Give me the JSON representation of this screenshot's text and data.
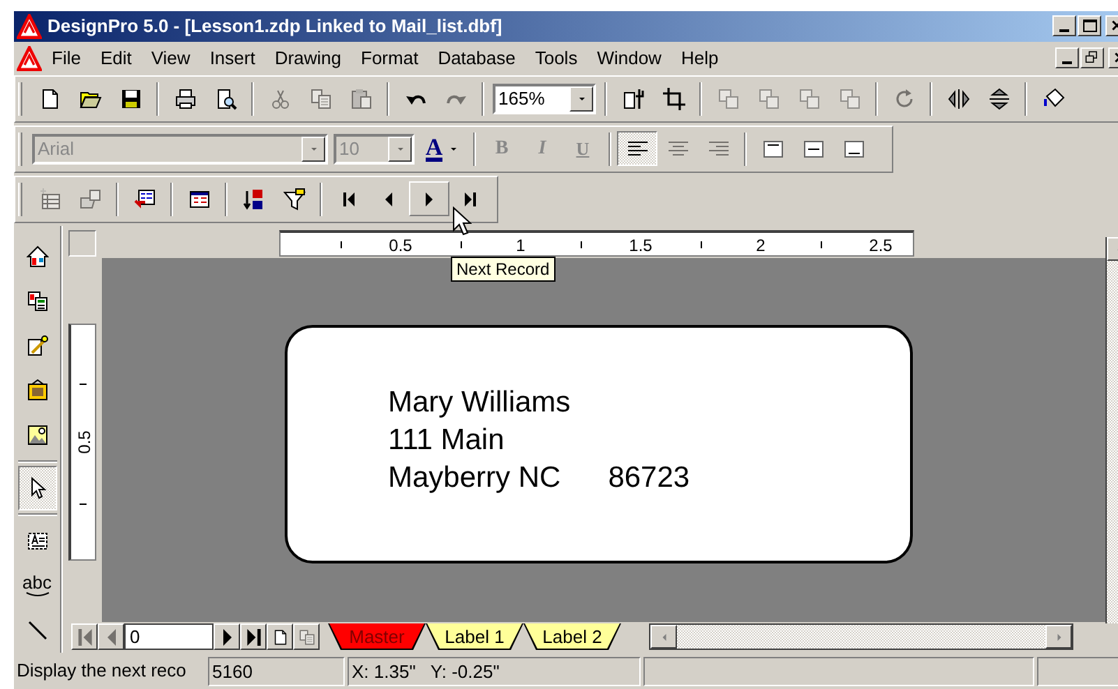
{
  "window": {
    "title": "DesignPro 5.0 - [Lesson1.zdp Linked to Mail_list.dbf]"
  },
  "menu": [
    "File",
    "Edit",
    "View",
    "Insert",
    "Drawing",
    "Format",
    "Database",
    "Tools",
    "Window",
    "Help"
  ],
  "toolbars": [
    {
      "items": [
        {
          "kind": "new",
          "disabled": false
        },
        {
          "kind": "open",
          "disabled": false
        },
        {
          "kind": "save",
          "disabled": false
        },
        {
          "kind": "sep"
        },
        {
          "kind": "print",
          "disabled": false
        },
        {
          "kind": "preview",
          "disabled": false
        },
        {
          "kind": "sep"
        },
        {
          "kind": "cut",
          "disabled": true
        },
        {
          "kind": "copy",
          "disabled": true
        },
        {
          "kind": "paste",
          "disabled": true
        },
        {
          "kind": "sep"
        },
        {
          "kind": "undo",
          "disabled": false
        },
        {
          "kind": "redo",
          "disabled": true
        },
        {
          "kind": "sep"
        },
        {
          "kind": "zoom",
          "value": "165%",
          "disabled": false
        },
        {
          "kind": "sep"
        },
        {
          "kind": "tools",
          "disabled": false
        },
        {
          "kind": "crop",
          "disabled": false
        },
        {
          "kind": "sep"
        },
        {
          "kind": "front",
          "disabled": true
        },
        {
          "kind": "forward",
          "disabled": true
        },
        {
          "kind": "back",
          "disabled": true
        },
        {
          "kind": "backward",
          "disabled": true
        },
        {
          "kind": "sep"
        },
        {
          "kind": "rotate",
          "disabled": true
        },
        {
          "kind": "sep"
        },
        {
          "kind": "fliph",
          "disabled": false
        },
        {
          "kind": "flipv",
          "disabled": false
        },
        {
          "kind": "sep"
        },
        {
          "kind": "paint",
          "disabled": false
        }
      ]
    },
    {
      "items": [
        {
          "kind": "font",
          "value": "Arial",
          "disabled": true
        },
        {
          "kind": "size",
          "value": "10",
          "disabled": true
        },
        {
          "kind": "fontcolor",
          "label": "A",
          "disabled": false
        },
        {
          "kind": "sep"
        },
        {
          "kind": "bold",
          "label": "B",
          "disabled": true
        },
        {
          "kind": "italic",
          "label": "I",
          "disabled": true
        },
        {
          "kind": "underline",
          "label": "U",
          "disabled": true
        },
        {
          "kind": "sep"
        },
        {
          "kind": "alignl",
          "selected": true,
          "disabled": false
        },
        {
          "kind": "alignc",
          "selected": false,
          "disabled": true
        },
        {
          "kind": "alignr",
          "selected": false,
          "disabled": true
        },
        {
          "kind": "sep"
        },
        {
          "kind": "vtop",
          "disabled": false
        },
        {
          "kind": "vmid",
          "disabled": false
        },
        {
          "kind": "vbot",
          "disabled": false
        }
      ]
    },
    {
      "items": [
        {
          "kind": "addrec",
          "disabled": true
        },
        {
          "kind": "openrec",
          "disabled": true
        },
        {
          "kind": "sep"
        },
        {
          "kind": "record",
          "disabled": false
        },
        {
          "kind": "sep"
        },
        {
          "kind": "table",
          "disabled": false
        },
        {
          "kind": "sep"
        },
        {
          "kind": "sort",
          "disabled": false
        },
        {
          "kind": "filter",
          "disabled": false
        },
        {
          "kind": "sep"
        },
        {
          "kind": "first",
          "hovered": false,
          "disabled": false
        },
        {
          "kind": "prev",
          "hovered": false,
          "disabled": false
        },
        {
          "kind": "next",
          "hovered": true,
          "disabled": false
        },
        {
          "kind": "last",
          "hovered": false,
          "disabled": false
        }
      ]
    }
  ],
  "toolbox": [
    {
      "kind": "house",
      "selected": false
    },
    {
      "kind": "layout",
      "selected": false
    },
    {
      "kind": "wand",
      "selected": false
    },
    {
      "kind": "frame",
      "selected": false
    },
    {
      "kind": "picture",
      "selected": false
    },
    {
      "kind": "sep"
    },
    {
      "kind": "pointer",
      "selected": true
    },
    {
      "kind": "sep"
    },
    {
      "kind": "textframe",
      "selected": false
    },
    {
      "kind": "arctext",
      "label": "abc",
      "selected": false
    },
    {
      "kind": "line",
      "selected": false
    }
  ],
  "tooltip": {
    "text": "Next Record"
  },
  "h_ruler": {
    "labels": [
      "0.5",
      "1",
      "1.5",
      "2",
      "2.5"
    ]
  },
  "v_ruler": {
    "labels": [
      "0.5"
    ]
  },
  "label": {
    "lines": [
      [
        "Mary Williams"
      ],
      [
        "111 Main"
      ],
      [
        "Mayberry NC",
        "86723"
      ]
    ]
  },
  "nav": {
    "before": [
      {
        "kind": "first",
        "disabled": true
      },
      {
        "kind": "prev",
        "disabled": true
      }
    ],
    "record": "0",
    "after": [
      {
        "kind": "next",
        "disabled": false
      },
      {
        "kind": "last",
        "disabled": false
      },
      {
        "kind": "newpage",
        "disabled": false
      },
      {
        "kind": "copypage",
        "disabled": true
      }
    ]
  },
  "tabs": [
    {
      "label": "Master",
      "selected": true,
      "color": "#ff0000"
    },
    {
      "label": "Label 1",
      "selected": false,
      "color": "#ffff99"
    },
    {
      "label": "Label 2",
      "selected": false,
      "color": "#ffff99"
    }
  ],
  "status": {
    "message": "Display the next reco",
    "label_type": "5160",
    "position": "X: 1.35\"   Y: -0.25\""
  }
}
